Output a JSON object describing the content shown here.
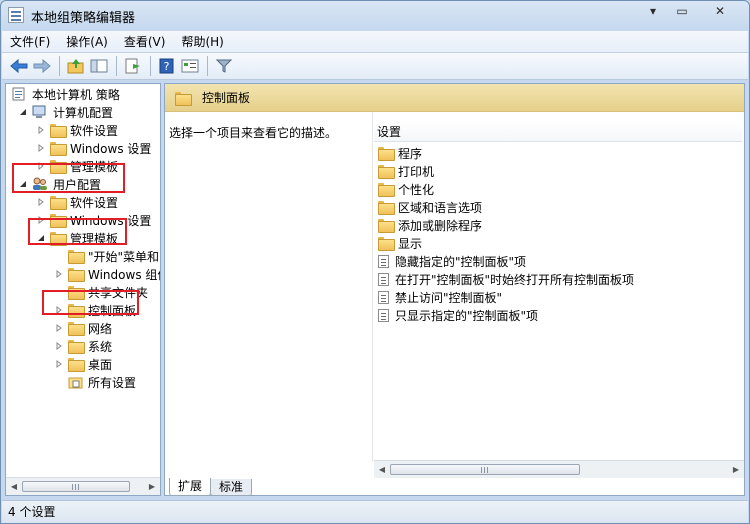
{
  "window": {
    "title": "本地组策略编辑器",
    "controls": {
      "minimize": "▾",
      "maximize": "▭",
      "close": "✕"
    }
  },
  "menu": [
    {
      "label": "文件(F)"
    },
    {
      "label": "操作(A)"
    },
    {
      "label": "查看(V)"
    },
    {
      "label": "帮助(H)"
    }
  ],
  "toolbar": {
    "icons": [
      "back-arrow-icon",
      "forward-arrow-icon",
      "up-folder-icon",
      "show-hide-tree-icon",
      "export-list-icon",
      "help-icon",
      "properties-icon",
      "filter-icon"
    ]
  },
  "tree": {
    "root": "本地计算机 策略",
    "computer_config": "计算机配置",
    "cc_software": "软件设置",
    "cc_windows": "Windows 设置",
    "cc_admin": "管理模板",
    "user_config": "用户配置",
    "uc_software": "软件设置",
    "uc_windows": "Windows 设置",
    "uc_admin": "管理模板",
    "start_menu": "\"开始\"菜单和",
    "windows_components": "Windows 组件",
    "shared_folders": "共享文件夹",
    "control_panel": "控制面板",
    "network": "网络",
    "system": "系统",
    "desktop": "桌面",
    "all_settings": "所有设置"
  },
  "content": {
    "header_title": "控制面板",
    "description": "选择一个项目来查看它的描述。",
    "column_header": "设置",
    "folders": [
      "程序",
      "打印机",
      "个性化",
      "区域和语言选项",
      "添加或删除程序",
      "显示"
    ],
    "policies": [
      "隐藏指定的\"控制面板\"项",
      "在打开\"控制面板\"时始终打开所有控制面板项",
      "禁止访问\"控制面板\"",
      "只显示指定的\"控制面板\"项"
    ]
  },
  "tabs": [
    {
      "label": "扩展",
      "active": true
    },
    {
      "label": "标准",
      "active": false
    }
  ],
  "status": {
    "text": "4 个设置"
  },
  "colors": {
    "highlight": "#e31d26",
    "header_band": "#e6d08a",
    "folder": "#efc15a",
    "window_frame": "#c5d8ee"
  }
}
